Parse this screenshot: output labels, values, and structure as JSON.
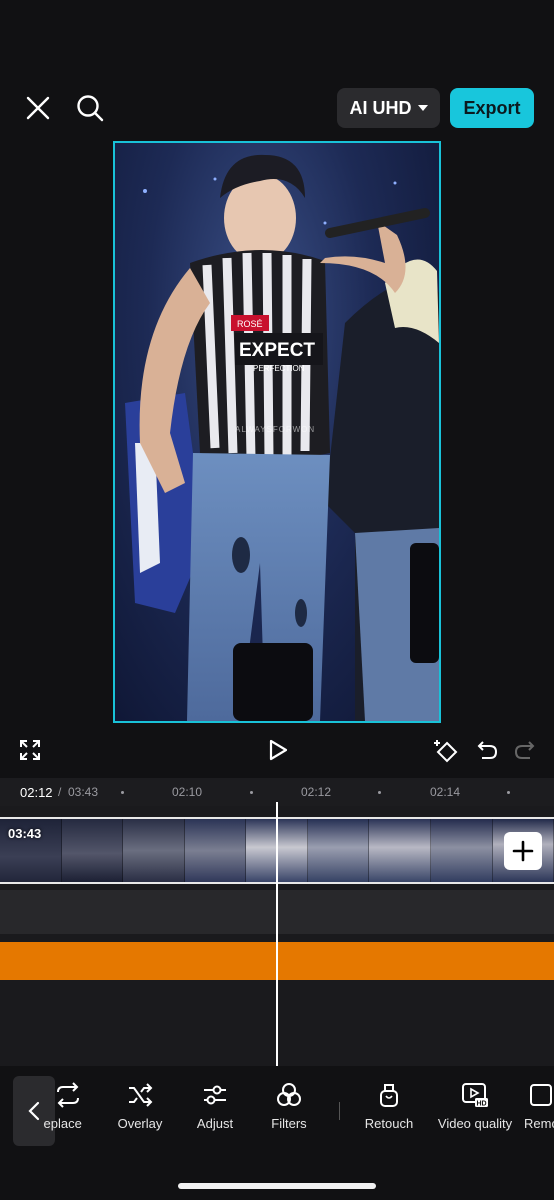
{
  "header": {
    "close_icon": "close-icon",
    "search_icon": "search-icon",
    "quality_label": "AI UHD",
    "export_label": "Export"
  },
  "preview": {
    "watermark": "ALWAYSFORWON",
    "shirt_text": "EXPECT",
    "shirt_subtext": "PERFECTION",
    "shirt_badge": "ROSÉ"
  },
  "playback": {
    "current_time": "02:12",
    "separator": "/",
    "total_time": "03:43",
    "ticks": [
      "02:10",
      "02:12",
      "02:14"
    ]
  },
  "timeline": {
    "clip_duration": "03:43",
    "add_icon": "plus-icon"
  },
  "toolbar": {
    "tools": [
      {
        "label": "Replace",
        "icon": "replace-icon"
      },
      {
        "label": "Overlay",
        "icon": "shuffle-icon"
      },
      {
        "label": "Adjust",
        "icon": "sliders-icon"
      },
      {
        "label": "Filters",
        "icon": "filters-icon"
      },
      {
        "label": "Retouch",
        "icon": "retouch-icon"
      },
      {
        "label": "Video quality",
        "icon": "video-hd-icon"
      },
      {
        "label": "Remove",
        "icon": "remove-icon"
      }
    ]
  },
  "colors": {
    "accent": "#18c6dc",
    "audio_track": "#e57800",
    "background": "#111113"
  }
}
